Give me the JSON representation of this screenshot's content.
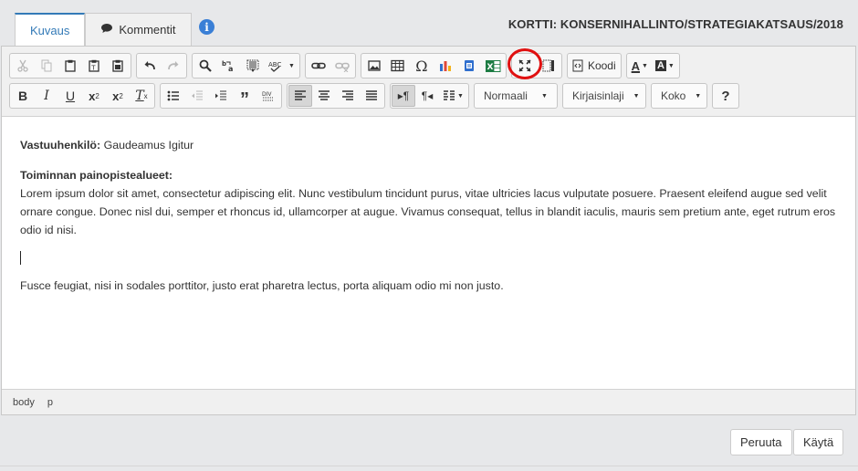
{
  "tabs": [
    {
      "label": "Kuvaus",
      "active": true
    },
    {
      "label": "Kommentit",
      "icon": "comment-icon",
      "active": false
    }
  ],
  "header": {
    "title": "KORTTI: KONSERNIHALLINTO/STRATEGIAKATSAUS/2018",
    "info_icon": "info-icon"
  },
  "toolbar": {
    "code_label": "Koodi",
    "format_combo": "Normaali",
    "font_combo": "Kirjaisinlaji",
    "size_combo": "Koko",
    "help_label": "?",
    "highlighted_button": "excel-button",
    "highlight_color": "#e01010"
  },
  "content": {
    "responsible_label": "Vastuuhenkilö:",
    "responsible_value": "Gaudeamus Igitur",
    "focus_heading": "Toiminnan painopistealueet:",
    "focus_text": "Lorem ipsum dolor sit amet, consectetur adipiscing elit. Nunc vestibulum tincidunt purus, vitae ultricies lacus vulputate posuere. Praesent eleifend augue sed velit ornare congue. Donec nisl dui, semper et rhoncus id, ullamcorper at augue. Vivamus consequat, tellus in blandit iaculis, mauris sem pretium ante, eget rutrum eros odio id nisi.",
    "last_paragraph": "Fusce feugiat, nisi in sodales porttitor, justo erat pharetra lectus, porta aliquam odio mi non justo."
  },
  "elements_path": [
    "body",
    "p"
  ],
  "actions": {
    "cancel_label": "Peruuta",
    "apply_label": "Käytä"
  },
  "colors": {
    "accent": "#337ab7",
    "info": "#3a7fd6",
    "excel": "#1d7c43"
  }
}
